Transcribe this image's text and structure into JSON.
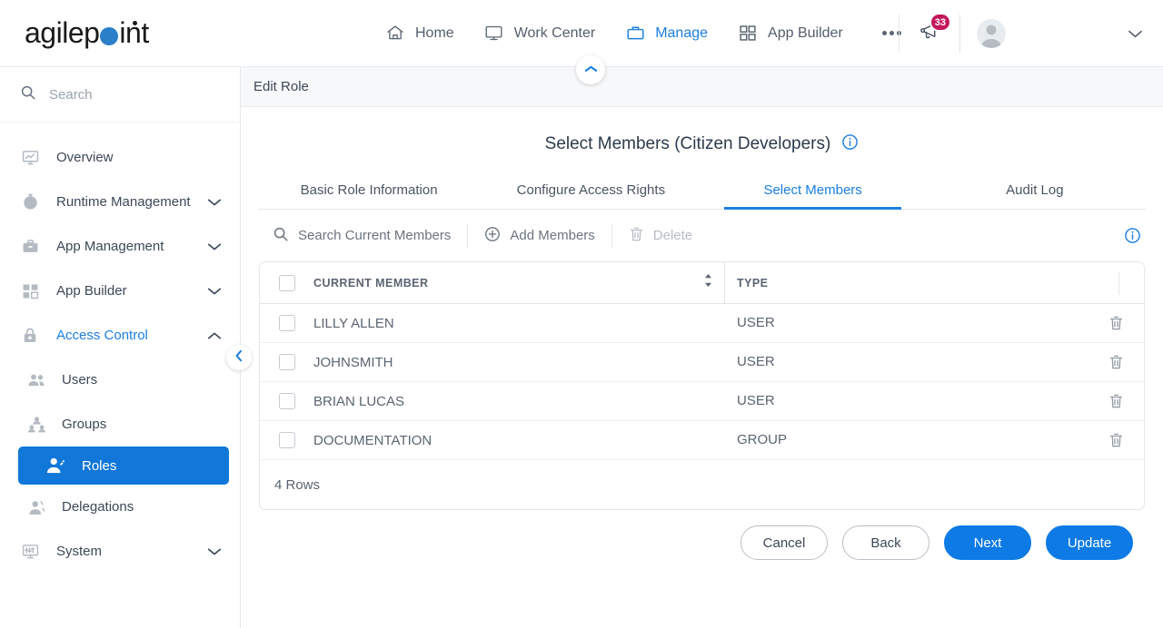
{
  "brand": {
    "name_part1": "agilep",
    "name_part2": "int",
    "dot_color": "#2b7fc9"
  },
  "topnav": {
    "items": [
      {
        "label": "Home",
        "icon": "home-icon",
        "active": false
      },
      {
        "label": "Work Center",
        "icon": "monitor-icon",
        "active": false
      },
      {
        "label": "Manage",
        "icon": "briefcase-icon",
        "active": true
      },
      {
        "label": "App Builder",
        "icon": "grid-icon",
        "active": false
      }
    ],
    "overflow_label": "...",
    "notification_count": "33",
    "user_name": "",
    "accent_color": "#1b7fe0"
  },
  "sidebar": {
    "search_placeholder": "Search",
    "items": [
      {
        "label": "Overview",
        "icon": "analytics-icon",
        "expandable": false,
        "state": "normal"
      },
      {
        "label": "Runtime Management",
        "icon": "clock-icon",
        "expandable": true,
        "state": "normal"
      },
      {
        "label": "App Management",
        "icon": "briefcase-icon",
        "expandable": true,
        "state": "normal"
      },
      {
        "label": "App Builder",
        "icon": "grid-icon",
        "expandable": true,
        "state": "normal"
      },
      {
        "label": "Access Control",
        "icon": "lock-icon",
        "expandable": true,
        "state": "accent",
        "expanded": true
      },
      {
        "label": "Users",
        "icon": "users-icon",
        "expandable": false,
        "state": "sub"
      },
      {
        "label": "Groups",
        "icon": "group-icon",
        "expandable": false,
        "state": "sub"
      },
      {
        "label": "Roles",
        "icon": "role-icon",
        "expandable": false,
        "state": "selected"
      },
      {
        "label": "Delegations",
        "icon": "delegation-icon",
        "expandable": false,
        "state": "sub"
      },
      {
        "label": "System",
        "icon": "system-icon",
        "expandable": true,
        "state": "normal"
      }
    ],
    "selected_bg": "#1177d8"
  },
  "breadcrumb": {
    "label": "Edit Role"
  },
  "main": {
    "title": "Select Members (Citizen Developers)",
    "tabs": [
      {
        "label": "Basic Role Information",
        "active": false
      },
      {
        "label": "Configure Access Rights",
        "active": false
      },
      {
        "label": "Select Members",
        "active": true
      },
      {
        "label": "Audit Log",
        "active": false
      }
    ],
    "toolbar": {
      "search_placeholder": "Search Current Members",
      "add_label": "Add Members",
      "delete_label": "Delete",
      "delete_disabled": true
    },
    "table": {
      "columns": [
        "CURRENT MEMBER",
        "TYPE"
      ],
      "rows": [
        {
          "member": "LILLY ALLEN",
          "type": "USER"
        },
        {
          "member": "JOHNSMITH",
          "type": "USER"
        },
        {
          "member": "BRIAN LUCAS",
          "type": "USER"
        },
        {
          "member": "DOCUMENTATION",
          "type": "GROUP"
        }
      ],
      "row_count_label": "4 Rows"
    },
    "buttons": [
      {
        "label": "Cancel",
        "style": "ghost"
      },
      {
        "label": "Back",
        "style": "ghost"
      },
      {
        "label": "Next",
        "style": "primary"
      },
      {
        "label": "Update",
        "style": "primary"
      }
    ]
  }
}
